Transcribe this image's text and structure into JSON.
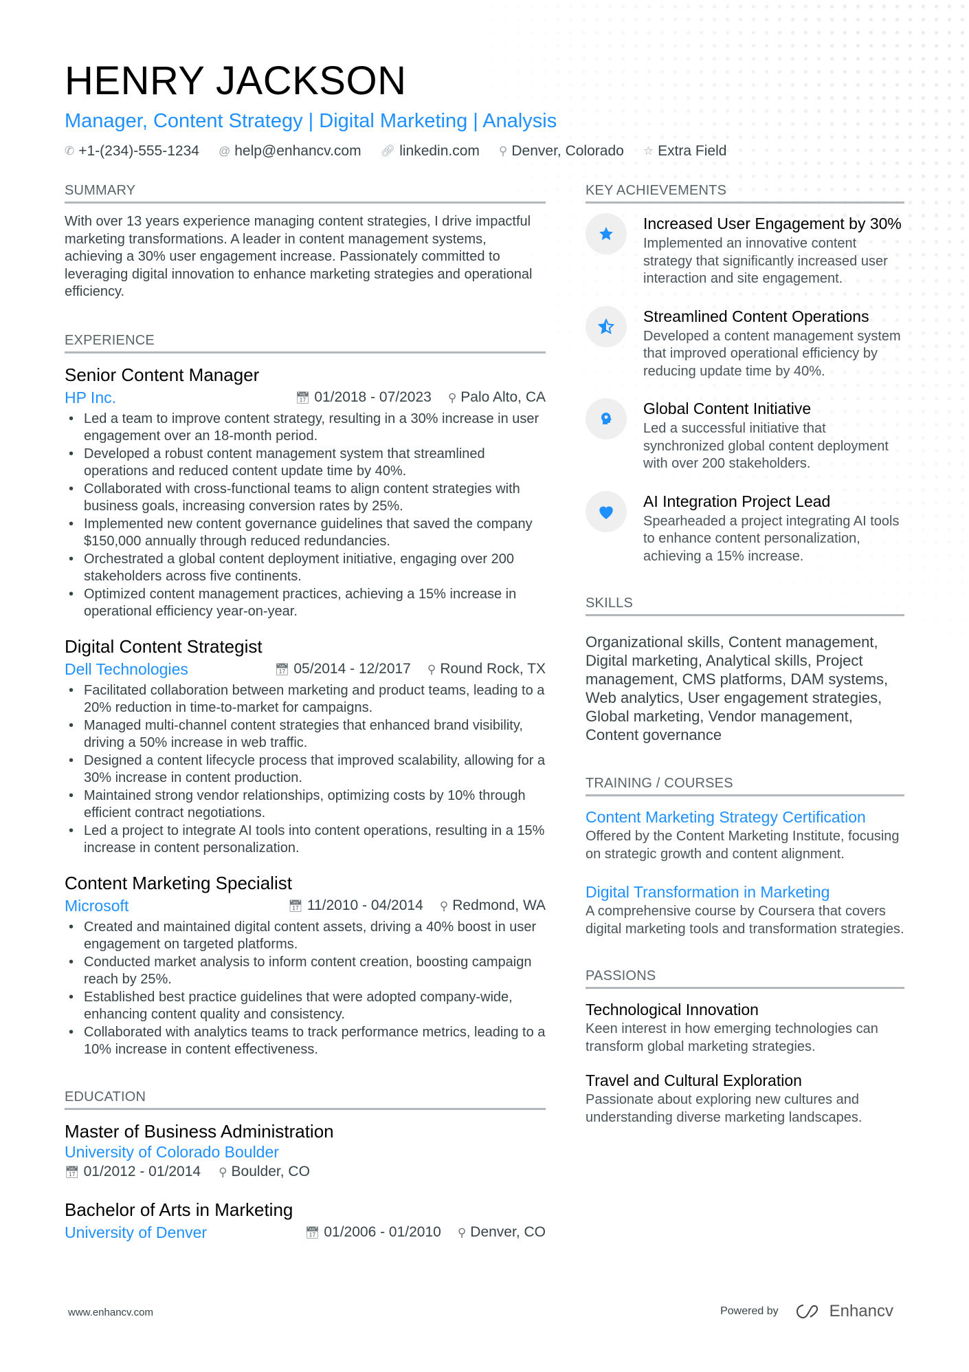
{
  "header": {
    "name": "HENRY JACKSON",
    "title": "Manager, Content Strategy | Digital Marketing | Analysis",
    "contacts": [
      {
        "icon": "phone-icon",
        "text": "+1-(234)-555-1234"
      },
      {
        "icon": "at-icon",
        "text": "help@enhancv.com"
      },
      {
        "icon": "link-icon",
        "text": "linkedin.com"
      },
      {
        "icon": "location-icon",
        "text": "Denver, Colorado"
      },
      {
        "icon": "star-icon",
        "text": "Extra Field"
      }
    ]
  },
  "summary": {
    "heading": "SUMMARY",
    "text": "With over 13 years experience managing content strategies, I drive impactful marketing transformations. A leader in content management systems, achieving a 30% user engagement increase. Passionately committed to leveraging digital innovation to enhance marketing strategies and operational efficiency."
  },
  "experience": {
    "heading": "EXPERIENCE",
    "jobs": [
      {
        "title": "Senior Content Manager",
        "company": "HP Inc.",
        "dates": "01/2018 - 07/2023",
        "location": "Palo Alto, CA",
        "bullets": [
          "Led a team to improve content strategy, resulting in a 30% increase in user engagement over an 18-month period.",
          "Developed a robust content management system that streamlined operations and reduced content update time by 40%.",
          "Collaborated with cross-functional teams to align content strategies with business goals, increasing conversion rates by 25%.",
          "Implemented new content governance guidelines that saved the company $150,000 annually through reduced redundancies.",
          "Orchestrated a global content deployment initiative, engaging over 200 stakeholders across five continents.",
          "Optimized content management practices, achieving a 15% increase in operational efficiency year-on-year."
        ]
      },
      {
        "title": "Digital Content Strategist",
        "company": "Dell Technologies",
        "dates": "05/2014 - 12/2017",
        "location": "Round Rock, TX",
        "bullets": [
          "Facilitated collaboration between marketing and product teams, leading to a 20% reduction in time-to-market for campaigns.",
          "Managed multi-channel content strategies that enhanced brand visibility, driving a 50% increase in web traffic.",
          "Designed a content lifecycle process that improved scalability, allowing for a 30% increase in content production.",
          "Maintained strong vendor relationships, optimizing costs by 10% through efficient contract negotiations.",
          "Led a project to integrate AI tools into content operations, resulting in a 15% increase in content personalization."
        ]
      },
      {
        "title": "Content Marketing Specialist",
        "company": "Microsoft",
        "dates": "11/2010 - 04/2014",
        "location": "Redmond, WA",
        "bullets": [
          "Created and maintained digital content assets, driving a 40% boost in user engagement on targeted platforms.",
          "Conducted market analysis to inform content creation, boosting campaign reach by 25%.",
          "Established best practice guidelines that were adopted company-wide, enhancing content quality and consistency.",
          "Collaborated with analytics teams to track performance metrics, leading to a 10% increase in content effectiveness."
        ]
      }
    ]
  },
  "education": {
    "heading": "EDUCATION",
    "items": [
      {
        "degree": "Master of Business Administration",
        "school": "University of Colorado Boulder",
        "dates": "01/2012 - 01/2014",
        "location": "Boulder, CO"
      },
      {
        "degree": "Bachelor of Arts in Marketing",
        "school": "University of Denver",
        "dates": "01/2006 - 01/2010",
        "location": "Denver, CO"
      }
    ]
  },
  "achievements": {
    "heading": "KEY ACHIEVEMENTS",
    "items": [
      {
        "icon": "star-icon",
        "title": "Increased User Engagement by 30%",
        "desc": "Implemented an innovative content strategy that significantly increased user interaction and site engagement."
      },
      {
        "icon": "half-star-icon",
        "title": "Streamlined Content Operations",
        "desc": "Developed a content management system that improved operational efficiency by reducing update time by 40%."
      },
      {
        "icon": "head-idea-icon",
        "title": "Global Content Initiative",
        "desc": "Led a successful initiative that synchronized global content deployment with over 200 stakeholders."
      },
      {
        "icon": "heart-icon",
        "title": "AI Integration Project Lead",
        "desc": "Spearheaded a project integrating AI tools to enhance content personalization, achieving a 15% increase."
      }
    ]
  },
  "skills": {
    "heading": "SKILLS",
    "text": "Organizational skills, Content management, Digital marketing, Analytical skills, Project management, CMS platforms, DAM systems, Web analytics, User engagement strategies, Global marketing, Vendor management, Content governance"
  },
  "training": {
    "heading": "TRAINING / COURSES",
    "items": [
      {
        "title": "Content Marketing Strategy Certification",
        "desc": "Offered by the Content Marketing Institute, focusing on strategic growth and content alignment."
      },
      {
        "title": "Digital Transformation in Marketing",
        "desc": "A comprehensive course by Coursera that covers digital marketing tools and transformation strategies."
      }
    ]
  },
  "passions": {
    "heading": "PASSIONS",
    "items": [
      {
        "title": "Technological Innovation",
        "desc": "Keen interest in how emerging technologies can transform global marketing strategies."
      },
      {
        "title": "Travel and Cultural Exploration",
        "desc": "Passionate about exploring new cultures and understanding diverse marketing landscapes."
      }
    ]
  },
  "footer": {
    "website": "www.enhancv.com",
    "powered_by": "Powered by",
    "brand": "Enhancv"
  },
  "colors": {
    "accent": "#1e90ff",
    "text": "#384347",
    "divider": "#b3b7ba"
  }
}
